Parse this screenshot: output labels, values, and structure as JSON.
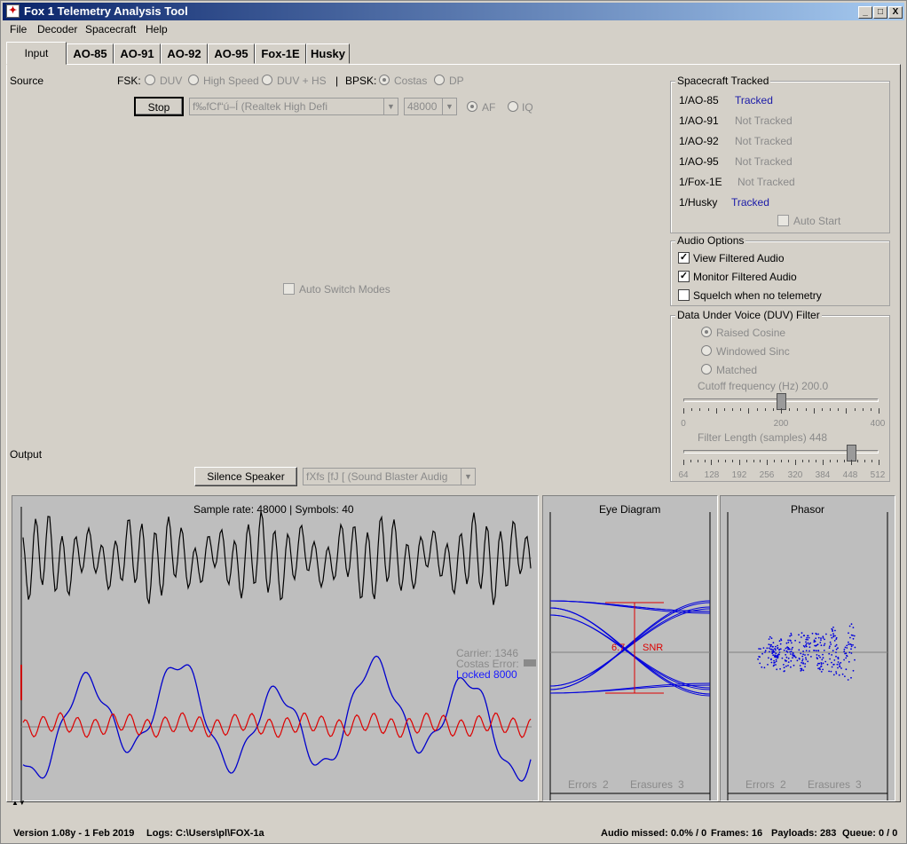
{
  "window": {
    "title": "Fox 1 Telemetry Analysis Tool",
    "app_icon": "fox-icon",
    "min_label": "_",
    "max_label": "□",
    "close_label": "X"
  },
  "menu": [
    "File",
    "Decoder",
    "Spacecraft",
    "Help"
  ],
  "tabs": [
    "Input",
    "AO-85",
    "AO-91",
    "AO-92",
    "AO-95",
    "Fox-1E",
    "Husky"
  ],
  "input": {
    "source_label": "Source",
    "fsk_label": "FSK:",
    "fsk_options": [
      "DUV",
      "High Speed",
      "DUV + HS"
    ],
    "sep": "|",
    "bpsk_label": "BPSK:",
    "bpsk_options": [
      "Costas",
      "DP"
    ],
    "bpsk_selected": "Costas",
    "stop_label": "Stop",
    "source_device": "f‰fCf“ú–Í (Realtek High Defi",
    "sample_rate": "48000",
    "af_label": "AF",
    "iq_label": "IQ",
    "af_selected": true,
    "auto_switch_label": "Auto Switch Modes",
    "output_label": "Output",
    "silence_label": "Silence Speaker",
    "output_device": "fXfs [fJ [ (Sound Blaster Audig"
  },
  "spacecraft": {
    "title": "Spacecraft Tracked",
    "items": [
      {
        "name": "1/AO-85",
        "status": "Tracked",
        "tracked": true
      },
      {
        "name": "1/AO-91",
        "status": "Not Tracked",
        "tracked": false
      },
      {
        "name": "1/AO-92",
        "status": "Not Tracked",
        "tracked": false
      },
      {
        "name": "1/AO-95",
        "status": "Not Tracked",
        "tracked": false
      },
      {
        "name": "1/Fox-1E",
        "status": "Not Tracked",
        "tracked": false
      },
      {
        "name": "1/Husky",
        "status": "Tracked",
        "tracked": true
      }
    ],
    "auto_start_label": "Auto Start"
  },
  "audio": {
    "title": "Audio Options",
    "options": [
      {
        "label": "View Filtered Audio",
        "checked": true
      },
      {
        "label": "Monitor Filtered Audio",
        "checked": true
      },
      {
        "label": "Squelch when no telemetry",
        "checked": false
      }
    ]
  },
  "duv": {
    "title": "Data Under Voice (DUV) Filter",
    "filters": [
      "Raised Cosine",
      "Windowed Sinc",
      "Matched"
    ],
    "selected": "Raised Cosine",
    "cutoff_label": "Cutoff frequency (Hz) 200.0",
    "cutoff_value": 200,
    "cutoff_ticks": [
      "0",
      "200",
      "400"
    ],
    "length_label": "Filter Length (samples) 448",
    "length_value": 448,
    "length_ticks": [
      "64",
      "128",
      "192",
      "256",
      "320",
      "384",
      "448",
      "512"
    ]
  },
  "scope": {
    "header": "Sample rate: 48000 | Symbols: 40",
    "carrier": "Carrier: 1346",
    "costas": "Costas Error: ",
    "locked": "Locked 8000",
    "audio_color": "#000000",
    "carrier_color": "#0000cc",
    "error_color": "#dd0000"
  },
  "eye": {
    "title": "Eye Diagram",
    "snr_value": "6.7",
    "snr_label": "SNR",
    "errors_label": "Errors",
    "errors": "2",
    "erasures_label": "Erasures",
    "erasures": "3",
    "trace_color": "#0000dd",
    "marker_color": "#dd0000"
  },
  "phasor": {
    "title": "Phasor",
    "errors_label": "Errors",
    "errors": "2",
    "erasures_label": "Erasures",
    "erasures": "3",
    "dot_color": "#0000dd"
  },
  "status": {
    "version": "Version 1.08y - 1 Feb 2019",
    "logs": "Logs: C:\\Users\\pl\\FOX-1a",
    "audio_missed": "Audio missed: 0.0% / 0",
    "frames": "Frames: 16",
    "payloads": "Payloads: 283",
    "queue": "Queue: 0 / 0"
  }
}
